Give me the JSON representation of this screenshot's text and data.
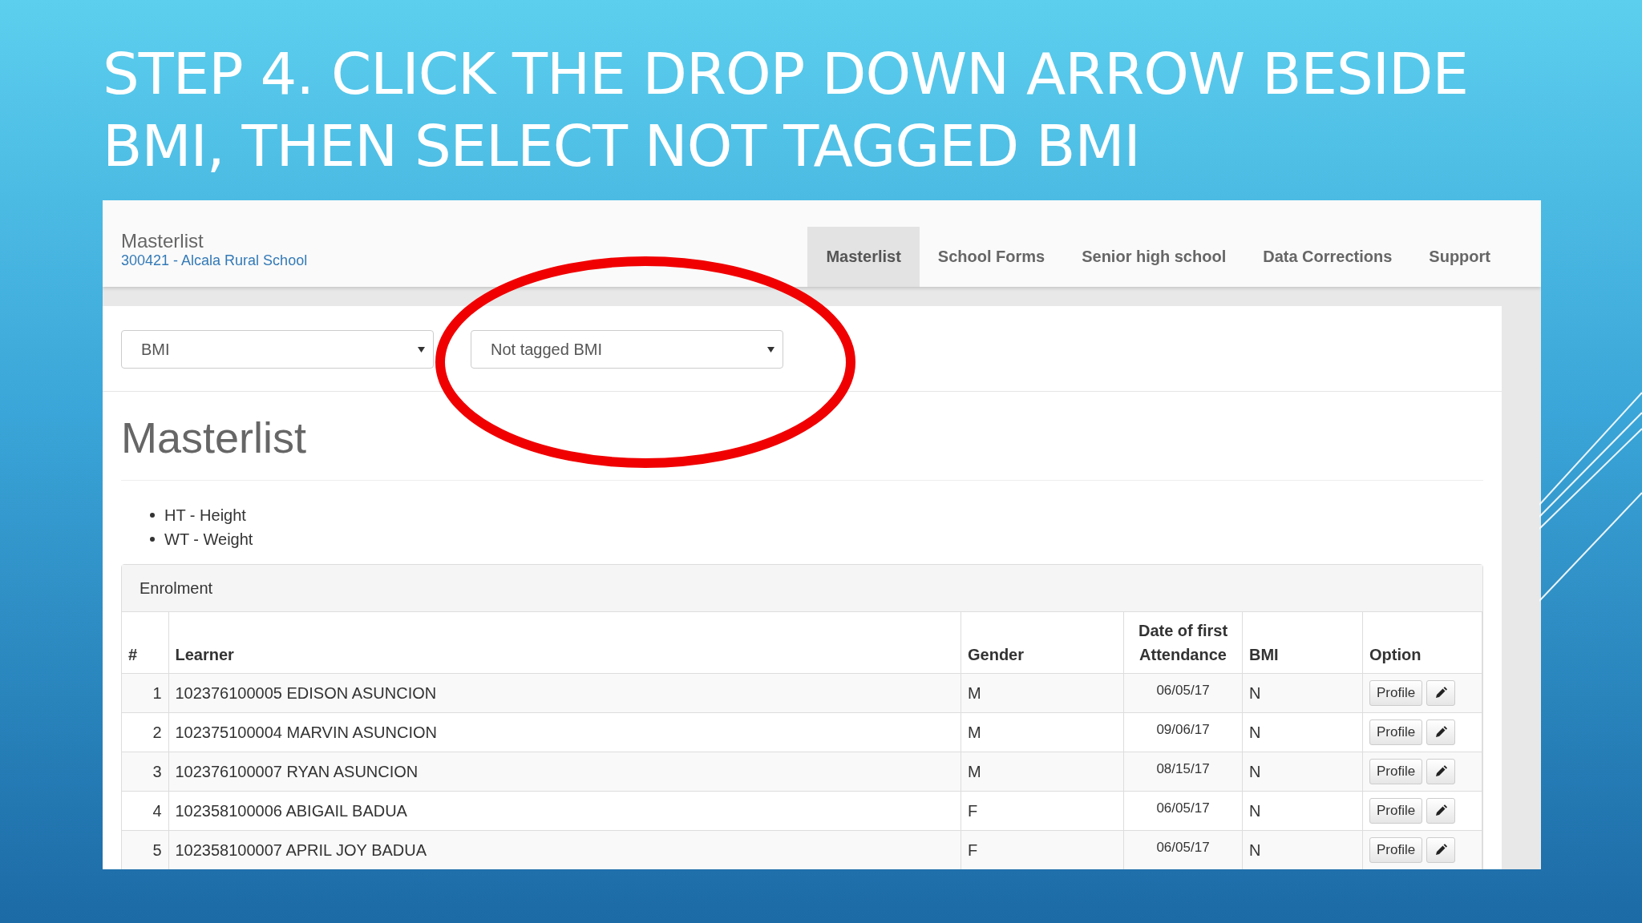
{
  "slide_title": "STEP 4. CLICK THE DROP DOWN ARROW BESIDE BMI, THEN SELECT NOT TAGGED BMI",
  "app": {
    "title": "Masterlist",
    "subtitle": "300421 - Alcala Rural School",
    "nav": [
      {
        "label": "Masterlist",
        "selected": true
      },
      {
        "label": "School Forms",
        "selected": false
      },
      {
        "label": "Senior high school",
        "selected": false
      },
      {
        "label": "Data Corrections",
        "selected": false
      },
      {
        "label": "Support",
        "selected": false
      }
    ],
    "filters": [
      {
        "value": "BMI"
      },
      {
        "value": "Not tagged BMI"
      }
    ],
    "heading": "Masterlist",
    "legend": [
      "HT - Height",
      "WT - Weight"
    ],
    "panel_title": "Enrolment",
    "table": {
      "columns": [
        "#",
        "Learner",
        "Gender",
        "Date of first Attendance",
        "BMI",
        "Option"
      ],
      "rows": [
        {
          "no": "1",
          "learner": "102376100005 EDISON ASUNCION",
          "gender": "M",
          "date": "06/05/17",
          "bmi": "N",
          "button": "Profile"
        },
        {
          "no": "2",
          "learner": "102375100004 MARVIN ASUNCION",
          "gender": "M",
          "date": "09/06/17",
          "bmi": "N",
          "button": "Profile"
        },
        {
          "no": "3",
          "learner": "102376100007 RYAN ASUNCION",
          "gender": "M",
          "date": "08/15/17",
          "bmi": "N",
          "button": "Profile"
        },
        {
          "no": "4",
          "learner": "102358100006 ABIGAIL BADUA",
          "gender": "F",
          "date": "06/05/17",
          "bmi": "N",
          "button": "Profile"
        },
        {
          "no": "5",
          "learner": "102358100007 APRIL JOY BADUA",
          "gender": "F",
          "date": "06/05/17",
          "bmi": "N",
          "button": "Profile"
        }
      ]
    }
  }
}
